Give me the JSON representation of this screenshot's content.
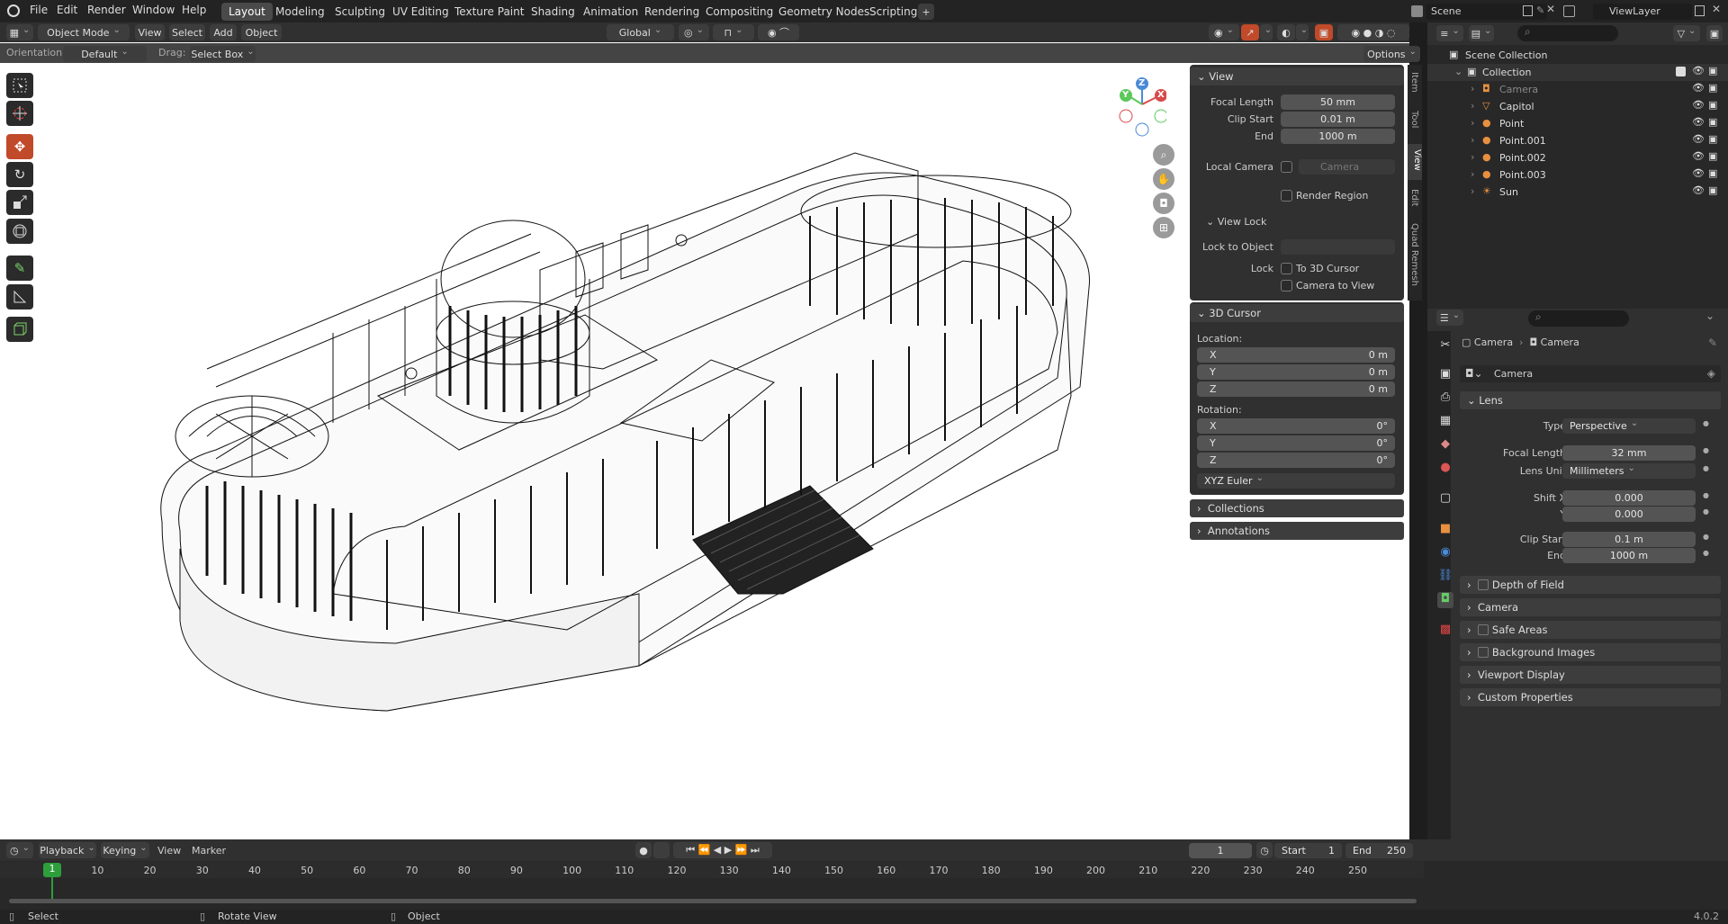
{
  "topbar": {
    "menus": [
      "File",
      "Edit",
      "Render",
      "Window",
      "Help"
    ],
    "tabs": [
      "Layout",
      "Modeling",
      "Sculpting",
      "UV Editing",
      "Texture Paint",
      "Shading",
      "Animation",
      "Rendering",
      "Compositing",
      "Geometry Nodes",
      "Scripting"
    ],
    "active_tab": "Layout",
    "add_tab": "+",
    "scene": "Scene",
    "view_layer": "ViewLayer"
  },
  "header": {
    "mode": "Object Mode",
    "menus": [
      "View",
      "Select",
      "Add",
      "Object"
    ],
    "transform_orientation": "Global",
    "options": "Options",
    "orientation_label": "Orientation:",
    "orientation_value": "Default",
    "drag_label": "Drag:",
    "drag_value": "Select Box"
  },
  "n_panel": {
    "tabs": [
      "Item",
      "Tool",
      "View",
      "Edit",
      "Quad Remesh"
    ],
    "view": {
      "title": "View",
      "focal_length_label": "Focal Length",
      "focal_length": "50 mm",
      "clip_start_label": "Clip Start",
      "clip_start": "0.01 m",
      "end_label": "End",
      "end": "1000 m",
      "local_camera_label": "Local Camera",
      "local_camera_placeholder": "Camera",
      "render_region": "Render Region"
    },
    "view_lock": {
      "title": "View Lock",
      "lock_object_label": "Lock to Object",
      "lock_label": "Lock",
      "to_cursor": "To 3D Cursor",
      "camera_to_view": "Camera to View"
    },
    "cursor": {
      "title": "3D Cursor",
      "location_label": "Location:",
      "loc": [
        {
          "axis": "X",
          "value": "0 m"
        },
        {
          "axis": "Y",
          "value": "0 m"
        },
        {
          "axis": "Z",
          "value": "0 m"
        }
      ],
      "rotation_label": "Rotation:",
      "rot": [
        {
          "axis": "X",
          "value": "0°"
        },
        {
          "axis": "Y",
          "value": "0°"
        },
        {
          "axis": "Z",
          "value": "0°"
        }
      ],
      "rotation_mode": "XYZ Euler"
    },
    "collections": "Collections",
    "annotations": "Annotations"
  },
  "gizmo": {
    "x": "X",
    "y": "Y",
    "z": "Z"
  },
  "outliner": {
    "root": "Scene Collection",
    "collection": "Collection",
    "items": [
      "Camera",
      "Capitol",
      "Point",
      "Point.001",
      "Point.002",
      "Point.003",
      "Sun"
    ]
  },
  "properties": {
    "breadcrumb_obj": "Camera",
    "breadcrumb_data": "Camera",
    "datablock": "Camera",
    "lens_title": "Lens",
    "type_label": "Type",
    "type_value": "Perspective",
    "focal_label": "Focal Length",
    "focal_value": "32 mm",
    "lens_unit_label": "Lens Unit",
    "lens_unit_value": "Millimeters",
    "shift_x_label": "Shift X",
    "shift_x": "0.000",
    "shift_y_label": "Y",
    "shift_y": "0.000",
    "clip_start_label": "Clip Start",
    "clip_start": "0.1 m",
    "clip_end_label": "End",
    "clip_end": "1000 m",
    "sections": [
      "Depth of Field",
      "Camera",
      "Safe Areas",
      "Background Images",
      "Viewport Display",
      "Custom Properties"
    ]
  },
  "timeline": {
    "menus": [
      "Playback",
      "Keying",
      "View",
      "Marker"
    ],
    "current_frame": "1",
    "start_label": "Start",
    "start": "1",
    "end_label": "End",
    "end": "250",
    "ticks": [
      "1",
      "10",
      "20",
      "30",
      "40",
      "50",
      "60",
      "70",
      "80",
      "90",
      "100",
      "110",
      "120",
      "130",
      "140",
      "150",
      "160",
      "170",
      "180",
      "190",
      "200",
      "210",
      "220",
      "230",
      "240",
      "250"
    ]
  },
  "statusbar": {
    "select": "Select",
    "rotate": "Rotate View",
    "object": "Object",
    "version": "4.0.2"
  },
  "colors": {
    "accent": "#4772b3",
    "active_tool": "#c04a2a",
    "frame_marker": "#2e9e3c"
  }
}
